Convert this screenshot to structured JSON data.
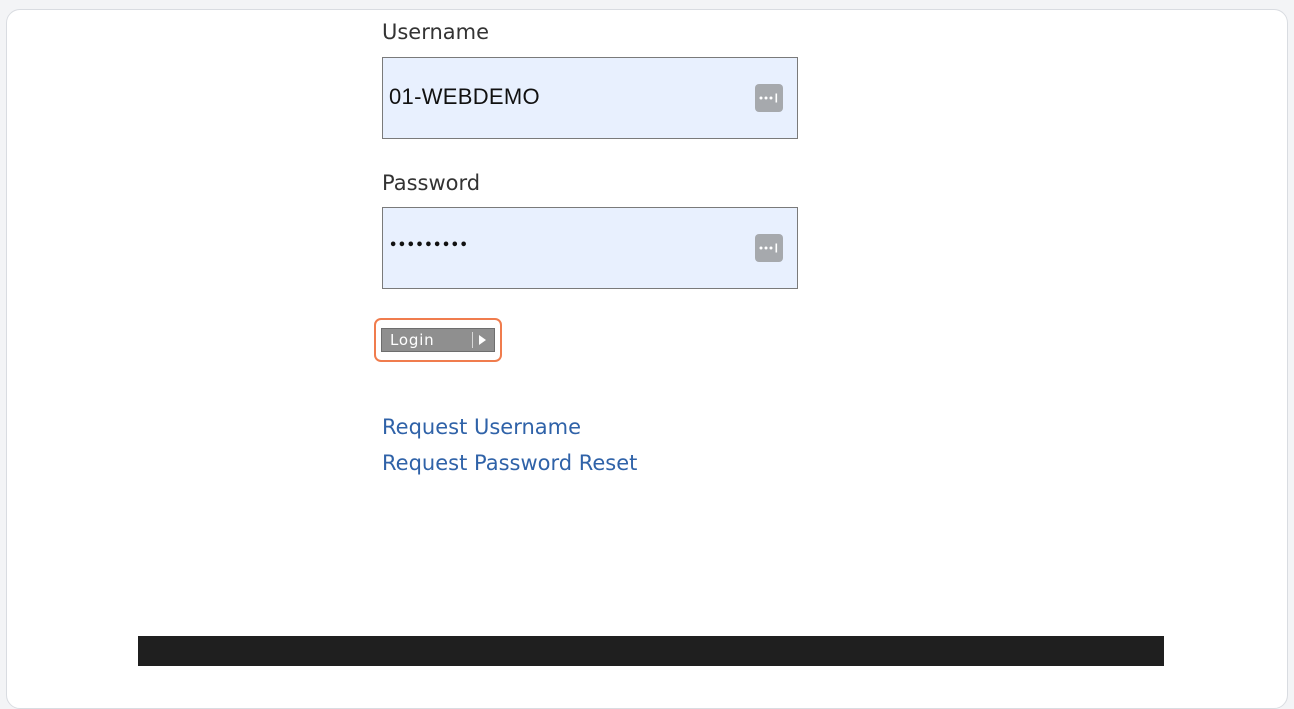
{
  "form": {
    "username_label": "Username",
    "username_value": "01-WEBDEMO",
    "password_label": "Password",
    "password_value": "•••••••••",
    "login_label": "Login"
  },
  "links": {
    "request_username": "Request Username",
    "request_password_reset": "Request Password Reset"
  },
  "icons": {
    "field_autofill": "password-manager-icon",
    "login_arrow": "play-arrow-icon"
  },
  "colors": {
    "field_background": "#e8f0fe",
    "link": "#2f62a8",
    "highlight": "#f07c4d",
    "button": "#8f8f8f"
  }
}
